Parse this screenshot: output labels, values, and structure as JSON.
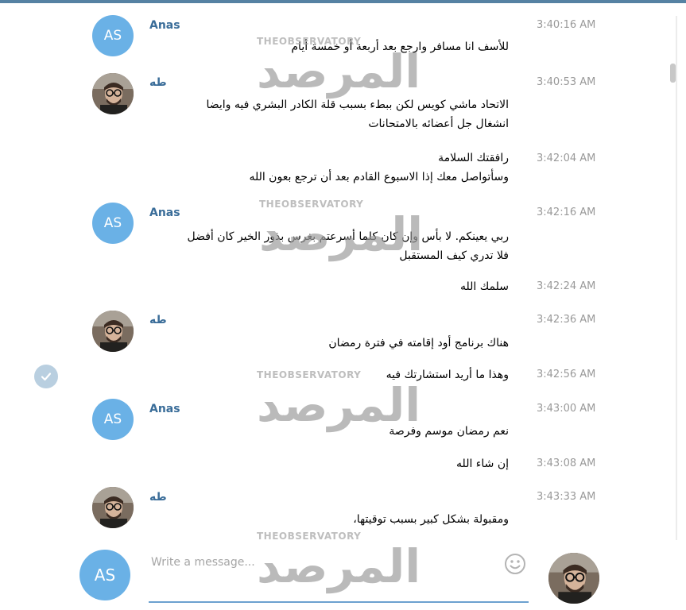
{
  "colors": {
    "accent": "#5682a3",
    "name": "#3a6d99",
    "avatar_bg": "#6ab1e6",
    "time": "#999999"
  },
  "messages": [
    {
      "id": 1,
      "sender": "Anas",
      "avatar": "AS",
      "time": "3:40:16 AM",
      "lines": [
        "للأسف انا مسافر وارجع بعد أربعة أو خمسة أيام"
      ]
    },
    {
      "id": 2,
      "sender": "طه",
      "avatar": "photo",
      "time": "3:40:53 AM",
      "lines": [
        "الاتحاد ماشي كويس لكن ببطء بسبب قلة الكادر البشري فيه وايضا",
        "انشغال جل أعضائه بالامتحانات"
      ]
    },
    {
      "id": 3,
      "time": "3:42:04 AM",
      "lines": [
        "رافقتك السلامة",
        "وسأتواصل معك إذا الاسبوع القادم بعد أن ترجع بعون الله"
      ]
    },
    {
      "id": 4,
      "sender": "Anas",
      "avatar": "AS",
      "time": "3:42:16 AM",
      "lines": [
        "ربي يعينكم. لا بأس وإن كان كلما أسرعتم بغرس بذور الخير كان أفضل",
        "فلا تدري كيف المستقبل"
      ]
    },
    {
      "id": 5,
      "time": "3:42:24 AM",
      "lines": [
        "سلمك الله"
      ]
    },
    {
      "id": 6,
      "sender": "طه",
      "avatar": "photo",
      "time": "3:42:36 AM",
      "lines": [
        "هناك برنامج أود إقامته في فترة رمضان"
      ]
    },
    {
      "id": 7,
      "time": "3:42:56 AM",
      "lines": [
        "وهذا ما أريد استشارتك فيه"
      ]
    },
    {
      "id": 8,
      "sender": "Anas",
      "avatar": "AS",
      "time": "3:43:00 AM",
      "lines": [
        "نعم رمضان موسم وفرصة"
      ]
    },
    {
      "id": 9,
      "time": "3:43:08 AM",
      "lines": [
        "إن شاء الله"
      ]
    },
    {
      "id": 10,
      "sender": "طه",
      "avatar": "photo",
      "time": "3:43:33 AM",
      "lines": [
        "ومقبولة بشكل كبير بسبب توقيتها،"
      ]
    }
  ],
  "composer": {
    "placeholder": "Write a message...",
    "own_avatar": "AS"
  },
  "watermark": {
    "top": "THEOBSERVATORY",
    "main": "المرصد"
  }
}
